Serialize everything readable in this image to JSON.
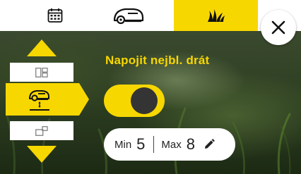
{
  "tabs": [
    {
      "name": "calendar",
      "icon": "calendar-icon",
      "active": false
    },
    {
      "name": "mower",
      "icon": "mower-icon",
      "active": false
    },
    {
      "name": "grass",
      "icon": "grass-icon",
      "active": true
    }
  ],
  "close": {
    "icon": "close-icon"
  },
  "title": "Napojit nejbl. drát",
  "toggle": {
    "state": "on"
  },
  "range": {
    "min_label": "Min",
    "min_value": "5",
    "max_label": "Max",
    "max_value": "8",
    "edit_icon": "pencil-icon"
  },
  "sidebar": {
    "up_icon": "arrow-up-icon",
    "down_icon": "arrow-down-icon",
    "modes": [
      {
        "icon": "layout-top-icon",
        "active": false
      },
      {
        "icon": "mower-wire-icon",
        "active": true
      },
      {
        "icon": "layout-bottom-icon",
        "active": false
      }
    ]
  },
  "colors": {
    "accent": "#f7d700",
    "dark": "#343434",
    "white": "#ffffff"
  }
}
